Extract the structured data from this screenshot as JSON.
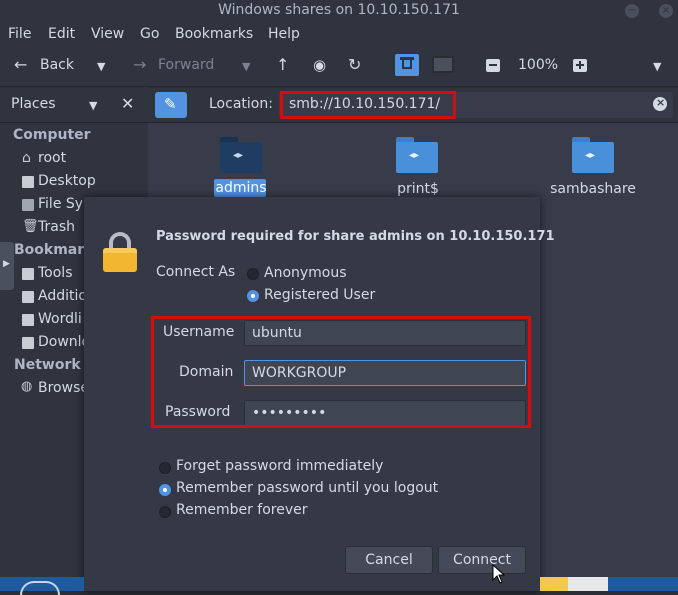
{
  "window": {
    "title": "Windows shares on 10.10.150.171"
  },
  "menubar": {
    "items": [
      "File",
      "Edit",
      "View",
      "Go",
      "Bookmarks",
      "Help"
    ]
  },
  "toolbar": {
    "back": "Back",
    "forward": "Forward",
    "zoom": "100%"
  },
  "sidebar": {
    "title": "Places",
    "computer_header": "Computer",
    "computer_items": [
      "root",
      "Desktop",
      "File Sys",
      "Trash"
    ],
    "bookmarks_header": "Bookmark",
    "bookmark_items": [
      "Tools",
      "Additio",
      "Wordli",
      "Downlo"
    ],
    "network_header": "Network",
    "network_items": [
      "Browse"
    ]
  },
  "location": {
    "label": "Location:",
    "value": "smb://10.10.150.171/"
  },
  "content": {
    "items": [
      "admins",
      "print$",
      "sambashare"
    ]
  },
  "dialog": {
    "title": "Password required for share admins on 10.10.150.171",
    "connect_as_label": "Connect As",
    "connect_as_options": [
      "Anonymous",
      "Registered User"
    ],
    "connect_as_selected": "Registered User",
    "username_label": "Username",
    "username_value": "ubuntu",
    "domain_label": "Domain",
    "domain_value": "WORKGROUP",
    "password_label": "Password",
    "password_value": "•••••••••",
    "remember_options": [
      "Forget password immediately",
      "Remember password until you logout",
      "Remember forever"
    ],
    "remember_selected": "Remember password until you logout",
    "cancel": "Cancel",
    "connect": "Connect"
  },
  "colors": {
    "accent": "#5294e2",
    "highlight": "#d40d0d",
    "folder_dark": "#1f3d63"
  }
}
